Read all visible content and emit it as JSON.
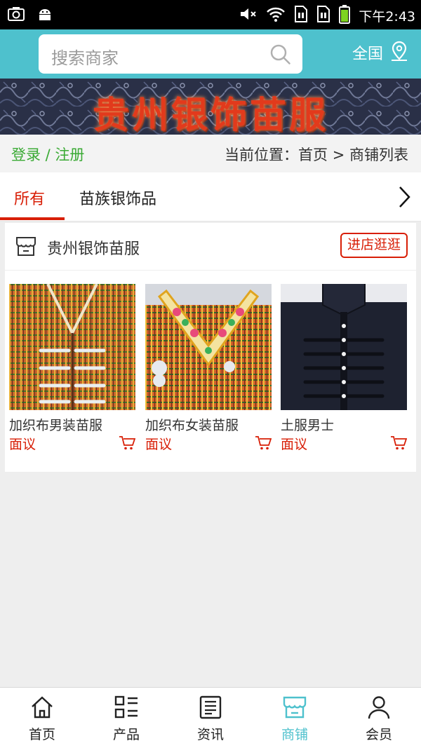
{
  "status_bar": {
    "time": "下午2:43",
    "icons": [
      "screenshot-icon",
      "android-icon",
      "mute-icon",
      "wifi-icon",
      "sim1-icon",
      "sim2-icon",
      "battery-icon"
    ]
  },
  "header": {
    "search_placeholder": "搜索商家",
    "region_label": "全国",
    "accent_color": "#4ec1cd"
  },
  "banner": {
    "title": "贵州银饰苗服"
  },
  "location_bar": {
    "login_register": "登录 / 注册",
    "breadcrumb": "当前位置：首页 > 商铺列表"
  },
  "tabs": [
    {
      "label": "所有",
      "active": true
    },
    {
      "label": "苗族银饰品",
      "active": false
    }
  ],
  "shop": {
    "name": "贵州银饰苗服",
    "visit_label": "进店逛逛",
    "products": [
      {
        "name": "加织布男装苗服",
        "price": "面议"
      },
      {
        "name": "加织布女装苗服",
        "price": "面议"
      },
      {
        "name": "土服男士",
        "price": "面议"
      }
    ]
  },
  "bottom_nav": [
    {
      "label": "首页",
      "icon": "home-icon",
      "active": false
    },
    {
      "label": "产品",
      "icon": "grid-list-icon",
      "active": false
    },
    {
      "label": "资讯",
      "icon": "news-icon",
      "active": false
    },
    {
      "label": "商铺",
      "icon": "shop-icon",
      "active": true
    },
    {
      "label": "会员",
      "icon": "user-icon",
      "active": false
    }
  ],
  "colors": {
    "accent": "#4ec1cd",
    "highlight_red": "#d81e06",
    "login_green": "#3aaa34"
  }
}
